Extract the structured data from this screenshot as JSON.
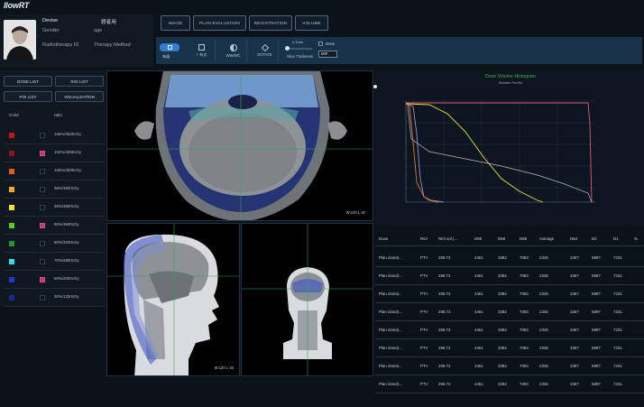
{
  "app": {
    "logo": "llowRT"
  },
  "patient": {
    "name": "Devise",
    "name_cn": "题者用",
    "gender_label": "Gender",
    "age_label": "age",
    "radiotherapy_id_label": "Radiotherapy ID",
    "therapy_method_label": "Therapy Method"
  },
  "nav": [
    "IMAGE",
    "PLAN EVALUATION",
    "REGISTRATION",
    "VOLUME"
  ],
  "tools": [
    {
      "label": "布局",
      "icon": "layout-icon"
    },
    {
      "label": "+ 布点",
      "icon": "crosshair-icon"
    },
    {
      "label": "WW/WC",
      "icon": "contrast-icon"
    },
    {
      "label": "ROTATE",
      "icon": "rotate-icon"
    }
  ],
  "slice": {
    "thickness_label": "Slice Thickness",
    "value": "0.1mm",
    "move_label": "Move",
    "mode": "MIP"
  },
  "left_buttons": [
    "DOSE LIST",
    "ROI LIST",
    "POI LIST",
    "VISUALIZATION"
  ],
  "color_table": {
    "col_color": "Color",
    "col_ratio": "ratio",
    "rows": [
      {
        "color": "#c0161c",
        "checked": false,
        "ratio": "105%/4620cGy"
      },
      {
        "color": "#8a1420",
        "checked": true,
        "ratio": "102%/4080cGy"
      },
      {
        "color": "#e8571c",
        "checked": false,
        "ratio": "100%/4000cGy"
      },
      {
        "color": "#f0a820",
        "checked": false,
        "ratio": "98%/3920cGy"
      },
      {
        "color": "#efe52e",
        "checked": false,
        "ratio": "95%/3800cGy"
      },
      {
        "color": "#4fd11c",
        "checked": true,
        "ratio": "90%/3600cGy"
      },
      {
        "color": "#1c9a2c",
        "checked": false,
        "ratio": "80%/3200cGy"
      },
      {
        "color": "#2ee0e8",
        "checked": false,
        "ratio": "70%/2800cGy"
      },
      {
        "color": "#2438c8",
        "checked": true,
        "ratio": "50%/2000cGy"
      },
      {
        "color": "#1a2a9e",
        "checked": false,
        "ratio": "30%/1200cGy"
      }
    ]
  },
  "viewers": {
    "axial_wl": "W:120 L:40",
    "sagittal_wl": "W:120 L:40"
  },
  "dvh": {
    "title": "Dose Volume Histogram",
    "subtitle": "Relative Per/No",
    "colors": {
      "pink": "#e0577a",
      "yellow": "#e7e32e",
      "purple": "#9b8bd6",
      "orange": "#e07a2c",
      "grey": "#8a96a3"
    }
  },
  "table": {
    "headers": [
      "Dose",
      "ROI",
      "ROI vol.(...",
      "D99",
      "D98",
      "D95",
      "Average",
      "D50",
      "D2",
      "D1",
      "%"
    ],
    "rows": [
      [
        "Plan dose(t...",
        "PTV",
        "298.72",
        "4461",
        "3382",
        "7083",
        "2336",
        "3367",
        "5897",
        "7231",
        ""
      ],
      [
        "Plan dose(t...",
        "PTV",
        "298.72",
        "4461",
        "3382",
        "7083",
        "2336",
        "3367",
        "5897",
        "7231",
        ""
      ],
      [
        "Plan dose(t...",
        "PTV",
        "298.72",
        "4461",
        "3382",
        "7083",
        "2336",
        "3367",
        "5897",
        "7231",
        ""
      ],
      [
        "Plan dose(t...",
        "PTV",
        "298.72",
        "4461",
        "3382",
        "7083",
        "2336",
        "3367",
        "5897",
        "7231",
        ""
      ],
      [
        "Plan dose(t...",
        "PTV",
        "298.72",
        "4461",
        "3382",
        "7083",
        "2336",
        "3367",
        "5897",
        "7231",
        ""
      ],
      [
        "Plan dose(t...",
        "PTV",
        "298.72",
        "4461",
        "3382",
        "7083",
        "2336",
        "3367",
        "5897",
        "7231",
        ""
      ],
      [
        "Plan dose(t...",
        "PTV",
        "298.72",
        "4461",
        "3382",
        "7083",
        "2336",
        "3367",
        "5897",
        "7231",
        ""
      ],
      [
        "Plan dose(t...",
        "PTV",
        "298.72",
        "4461",
        "3382",
        "7083",
        "2336",
        "3367",
        "5897",
        "7231",
        ""
      ]
    ]
  }
}
